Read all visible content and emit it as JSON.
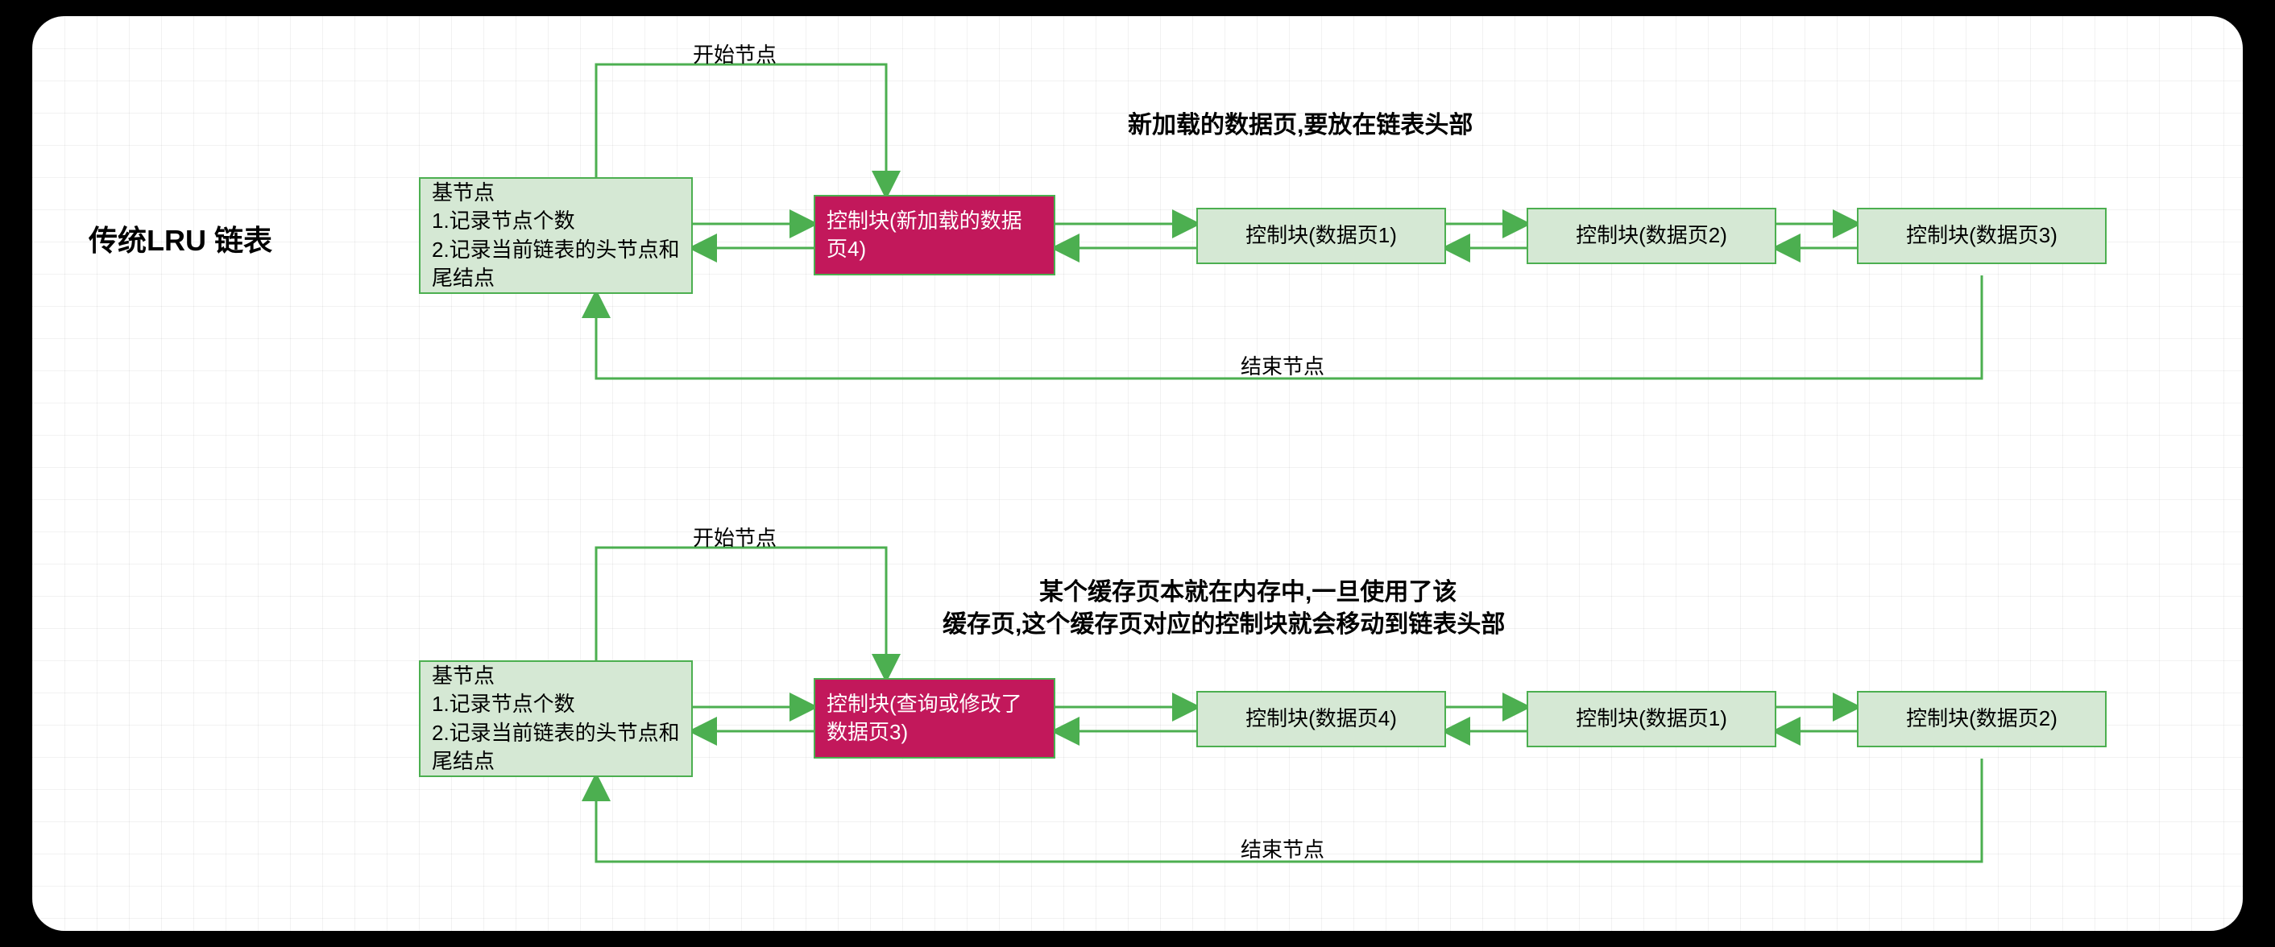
{
  "title": "传统LRU 链表",
  "top": {
    "start_label": "开始节点",
    "end_label": "结束节点",
    "caption": "新加载的数据页,要放在链表头部",
    "base_node": "基节点\n1.记录节点个数\n2.记录当前链表的头节点和尾结点",
    "pink_node": "控制块(新加载的数据页4)",
    "n1": "控制块(数据页1)",
    "n2": "控制块(数据页2)",
    "n3": "控制块(数据页3)"
  },
  "bottom": {
    "start_label": "开始节点",
    "end_label": "结束节点",
    "caption_line1": "某个缓存页本就在内存中,一旦使用了该",
    "caption_line2": "缓存页,这个缓存页对应的控制块就会移动到链表头部",
    "base_node": "基节点\n1.记录节点个数\n2.记录当前链表的头节点和尾结点",
    "pink_node": "控制块(查询或修改了数据页3)",
    "n1": "控制块(数据页4)",
    "n2": "控制块(数据页1)",
    "n3": "控制块(数据页2)"
  },
  "colors": {
    "line": "#4caf50",
    "node_fill": "#d5e8d4",
    "pink_fill": "#c2185b"
  }
}
